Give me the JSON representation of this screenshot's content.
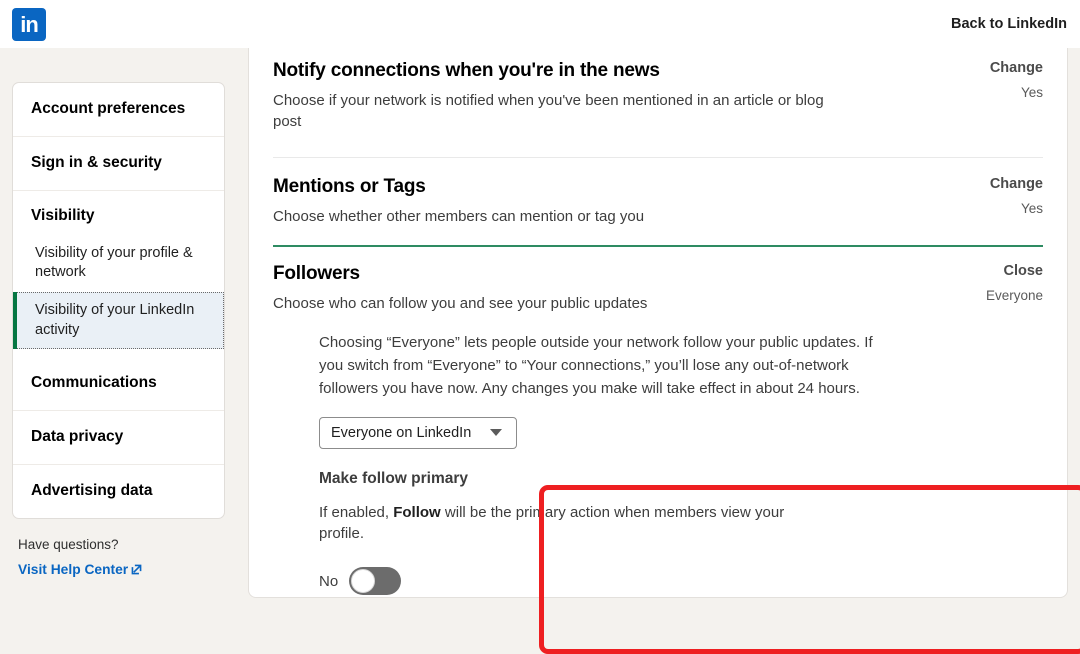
{
  "header": {
    "logo_icon": "linkedin-logo-icon",
    "logo_text": "in",
    "back_label": "Back to LinkedIn"
  },
  "sidebar": {
    "items": [
      {
        "label": "Account preferences",
        "type": "primary"
      },
      {
        "label": "Sign in & security",
        "type": "primary"
      },
      {
        "label": "Visibility",
        "type": "group-head"
      },
      {
        "label": "Visibility of your profile & network",
        "type": "sub"
      },
      {
        "label": "Visibility of your LinkedIn activity",
        "type": "sub-active"
      },
      {
        "label": "Communications",
        "type": "primary"
      },
      {
        "label": "Data privacy",
        "type": "primary"
      },
      {
        "label": "Advertising data",
        "type": "primary"
      }
    ],
    "help": {
      "question": "Have questions?",
      "link_label": "Visit Help Center",
      "link_icon": "external-link-icon",
      "link_color": "#0a66c2"
    },
    "active_bar_color": "#057642",
    "active_bg_color": "#eaf0f6"
  },
  "main": {
    "sections": [
      {
        "title": "Notify connections when you're in the news",
        "description": "Choose if your network is notified when you've been mentioned in an article or blog post",
        "action_label": "Change",
        "action_value": "Yes"
      },
      {
        "title": "Mentions or Tags",
        "description": "Choose whether other members can mention or tag you",
        "action_label": "Change",
        "action_value": "Yes"
      },
      {
        "title": "Followers",
        "description": "Choose who can follow you and see your public updates",
        "action_label": "Close",
        "action_value": "Everyone"
      }
    ],
    "followers_expanded": {
      "explanation": "Choosing “Everyone” lets people outside your network follow your public updates. If you switch from “Everyone” to “Your connections,” you’ll lose any out-of-network followers you have now. Any changes you make will take effect in about 24 hours.",
      "select_value": "Everyone on LinkedIn",
      "select_icon": "chevron-down-icon",
      "follow_primary": {
        "title": "Make follow primary",
        "desc_before": "If enabled, ",
        "desc_bold": "Follow",
        "desc_after": " will be the primary action when members view your profile.",
        "toggle_label": "No",
        "toggle_state": "off"
      }
    },
    "separator_green_color": "#2e8b62",
    "highlight_box_color": "#ee1f21"
  }
}
